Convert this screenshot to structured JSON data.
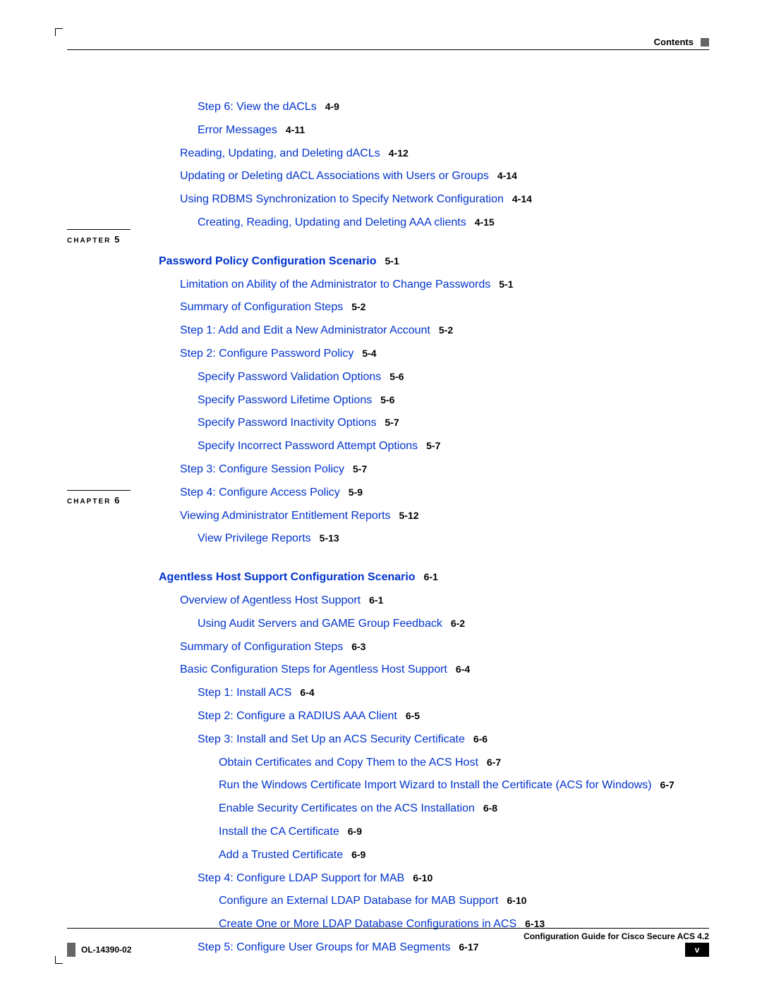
{
  "header": {
    "label": "Contents"
  },
  "footer": {
    "title": "Configuration Guide for Cisco Secure ACS 4.2",
    "docnum": "OL-14390-02",
    "pagenum": "v"
  },
  "chapters": {
    "ch5": {
      "label": "CHAPTER",
      "num": "5"
    },
    "ch6": {
      "label": "CHAPTER",
      "num": "6"
    }
  },
  "toc": {
    "l01": {
      "text": "Step 6: View the dACLs",
      "ref": "4-9"
    },
    "l02": {
      "text": "Error Messages",
      "ref": "4-11"
    },
    "l03": {
      "text": "Reading, Updating, and Deleting dACLs",
      "ref": "4-12"
    },
    "l04": {
      "text": "Updating or Deleting dACL Associations with Users or Groups",
      "ref": "4-14"
    },
    "l05": {
      "text": "Using RDBMS Synchronization to Specify Network Configuration",
      "ref": "4-14"
    },
    "l06": {
      "text": "Creating, Reading, Updating and Deleting AAA clients",
      "ref": "4-15"
    },
    "l07": {
      "text": "Password Policy Configuration Scenario",
      "ref": "5-1"
    },
    "l08": {
      "text": "Limitation on Ability of the Administrator to Change Passwords",
      "ref": "5-1"
    },
    "l09": {
      "text": "Summary of Configuration Steps",
      "ref": "5-2"
    },
    "l10": {
      "text": "Step 1: Add and Edit a New Administrator Account",
      "ref": "5-2"
    },
    "l11": {
      "text": "Step 2: Configure Password Policy",
      "ref": "5-4"
    },
    "l12": {
      "text": "Specify Password Validation Options",
      "ref": "5-6"
    },
    "l13": {
      "text": "Specify Password Lifetime Options",
      "ref": "5-6"
    },
    "l14": {
      "text": "Specify Password Inactivity Options",
      "ref": "5-7"
    },
    "l15": {
      "text": "Specify Incorrect Password Attempt Options",
      "ref": "5-7"
    },
    "l16": {
      "text": "Step 3: Configure Session Policy",
      "ref": "5-7"
    },
    "l17": {
      "text": "Step 4: Configure Access Policy",
      "ref": "5-9"
    },
    "l18": {
      "text": "Viewing Administrator Entitlement Reports",
      "ref": "5-12"
    },
    "l19": {
      "text": "View Privilege Reports",
      "ref": "5-13"
    },
    "l20": {
      "text": "Agentless Host Support Configuration Scenario",
      "ref": "6-1"
    },
    "l21": {
      "text": "Overview of Agentless Host Support",
      "ref": "6-1"
    },
    "l22": {
      "text": "Using Audit Servers and GAME Group Feedback",
      "ref": "6-2"
    },
    "l23": {
      "text": "Summary of Configuration Steps",
      "ref": "6-3"
    },
    "l24": {
      "text": "Basic Configuration Steps for Agentless Host Support",
      "ref": "6-4"
    },
    "l25": {
      "text": "Step 1: Install ACS",
      "ref": "6-4"
    },
    "l26": {
      "text": "Step 2: Configure a RADIUS AAA Client",
      "ref": "6-5"
    },
    "l27": {
      "text": "Step 3: Install and Set Up an ACS Security Certificate",
      "ref": "6-6"
    },
    "l28": {
      "text": "Obtain Certificates and Copy Them to the ACS Host",
      "ref": "6-7"
    },
    "l29": {
      "text": "Run the Windows Certificate Import Wizard to Install the Certificate (ACS for Windows)",
      "ref": "6-7"
    },
    "l30": {
      "text": "Enable Security Certificates on the ACS Installation",
      "ref": "6-8"
    },
    "l31": {
      "text": "Install the CA Certificate",
      "ref": "6-9"
    },
    "l32": {
      "text": "Add a Trusted Certificate",
      "ref": "6-9"
    },
    "l33": {
      "text": "Step 4: Configure LDAP Support for MAB",
      "ref": "6-10"
    },
    "l34": {
      "text": "Configure an External LDAP Database for MAB Support",
      "ref": "6-10"
    },
    "l35": {
      "text": "Create One or More LDAP Database Configurations in ACS",
      "ref": "6-13"
    },
    "l36": {
      "text": "Step 5: Configure User Groups for MAB Segments",
      "ref": "6-17"
    }
  }
}
